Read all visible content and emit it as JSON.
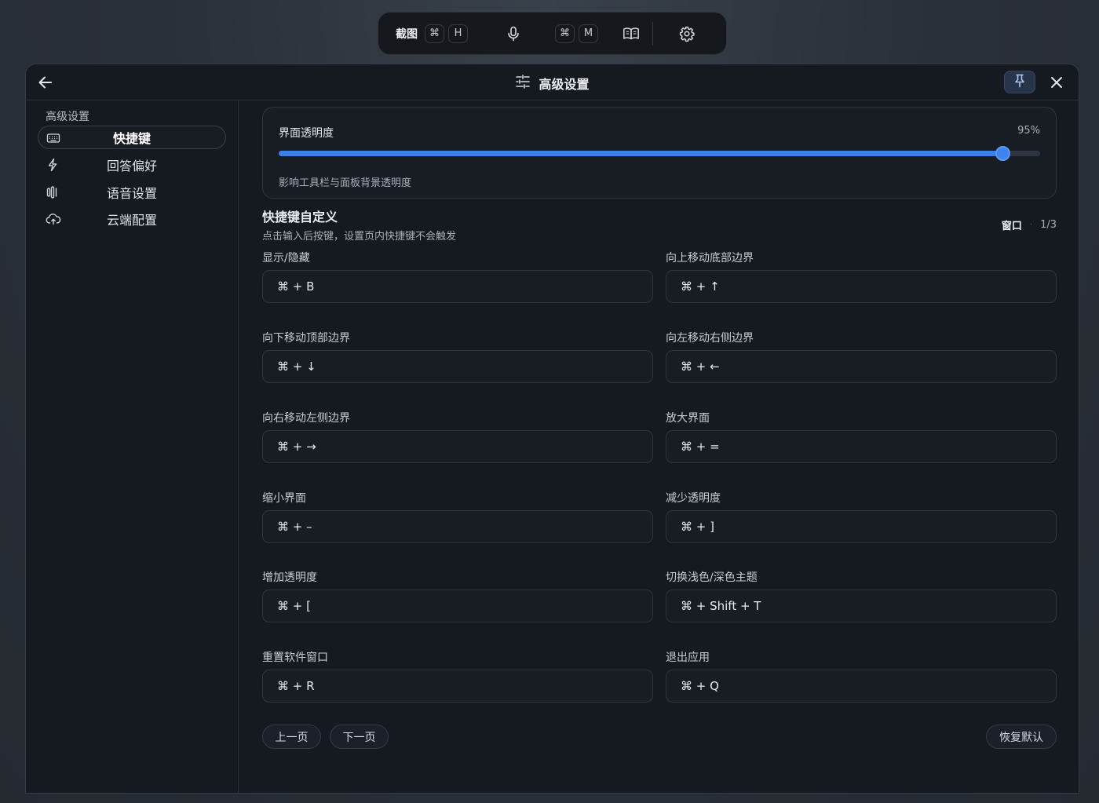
{
  "toolbar": {
    "screenshot_label": "截图",
    "screenshot_keys": [
      "⌘",
      "H"
    ],
    "voice_keys": [
      "⌘",
      "M"
    ],
    "icons": [
      "microphone-icon",
      "book-icon",
      "gear-icon"
    ]
  },
  "window": {
    "title": "高级设置",
    "icons": [
      "back-arrow-icon",
      "sliders-icon",
      "pin-icon",
      "close-icon"
    ]
  },
  "sidebar": {
    "heading": "高级设置",
    "items": [
      {
        "label": "快捷键",
        "icon": "keyboard-icon",
        "active": true
      },
      {
        "label": "回答偏好",
        "icon": "lightning-icon",
        "active": false
      },
      {
        "label": "语音设置",
        "icon": "audio-wave-icon",
        "active": false
      },
      {
        "label": "云端配置",
        "icon": "cloud-icon",
        "active": false
      }
    ]
  },
  "opacity": {
    "title": "界面透明度",
    "value_text": "95%",
    "value": 0.95,
    "description": "影响工具栏与面板背景透明度"
  },
  "shortcuts": {
    "title": "快捷键自定义",
    "subtitle": "点击输入后按键，设置页内快捷键不会触发",
    "category": "窗口",
    "page": "1/3",
    "items": [
      {
        "label": "显示/隐藏",
        "keys": "⌘ + B"
      },
      {
        "label": "向上移动底部边界",
        "keys": "⌘ + ↑"
      },
      {
        "label": "向下移动顶部边界",
        "keys": "⌘ + ↓"
      },
      {
        "label": "向左移动右侧边界",
        "keys": "⌘ + ←"
      },
      {
        "label": "向右移动左侧边界",
        "keys": "⌘ + →"
      },
      {
        "label": "放大界面",
        "keys": "⌘ + ="
      },
      {
        "label": "缩小界面",
        "keys": "⌘ + –"
      },
      {
        "label": "减少透明度",
        "keys": "⌘ + ]"
      },
      {
        "label": "增加透明度",
        "keys": "⌘ + ["
      },
      {
        "label": "切换浅色/深色主题",
        "keys": "⌘ + Shift + T"
      },
      {
        "label": "重置软件窗口",
        "keys": "⌘ + R"
      },
      {
        "label": "退出应用",
        "keys": "⌘ + Q"
      }
    ]
  },
  "buttons": {
    "prev": "上一页",
    "next": "下一页",
    "reset": "恢复默认"
  },
  "colors": {
    "accent": "#3b7fe8",
    "background": "#151920"
  }
}
